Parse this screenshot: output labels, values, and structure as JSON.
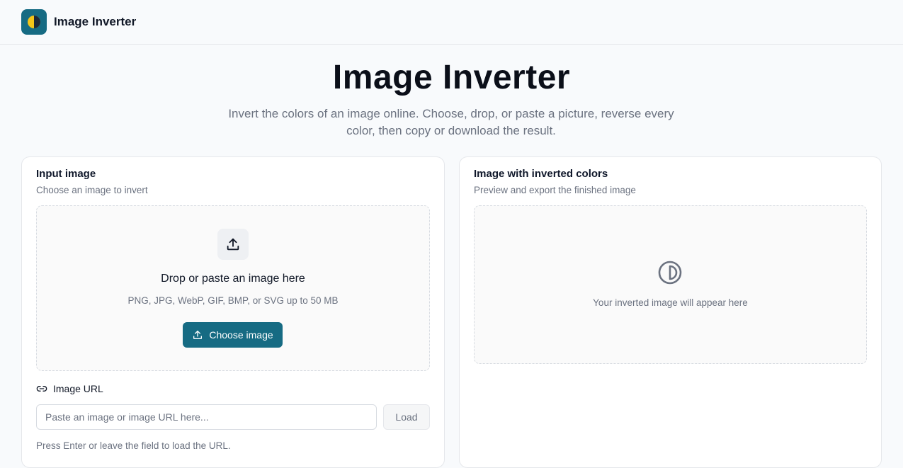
{
  "header": {
    "brand": "Image Inverter"
  },
  "hero": {
    "title": "Image Inverter",
    "subtitle": "Invert the colors of an image online. Choose, drop, or paste a picture, reverse every color, then copy or download the result."
  },
  "input_card": {
    "title": "Input image",
    "subtitle": "Choose an image to invert",
    "dropzone": {
      "title": "Drop or paste an image here",
      "formats": "PNG, JPG, WebP, GIF, BMP, or SVG up to 50 MB",
      "button_label": "Choose image"
    },
    "url": {
      "label": "Image URL",
      "placeholder": "Paste an image or image URL here...",
      "value": "",
      "load_label": "Load",
      "hint": "Press Enter or leave the field to load the URL."
    }
  },
  "output_card": {
    "title": "Image with inverted colors",
    "subtitle": "Preview and export the finished image",
    "empty_text": "Your inverted image will appear here"
  },
  "icons": {
    "logo": "half-circle-logo-icon",
    "upload": "upload-icon",
    "link": "link-icon",
    "invert": "contrast-icon"
  },
  "colors": {
    "accent": "#166b83",
    "logo_yellow": "#f5c518"
  }
}
